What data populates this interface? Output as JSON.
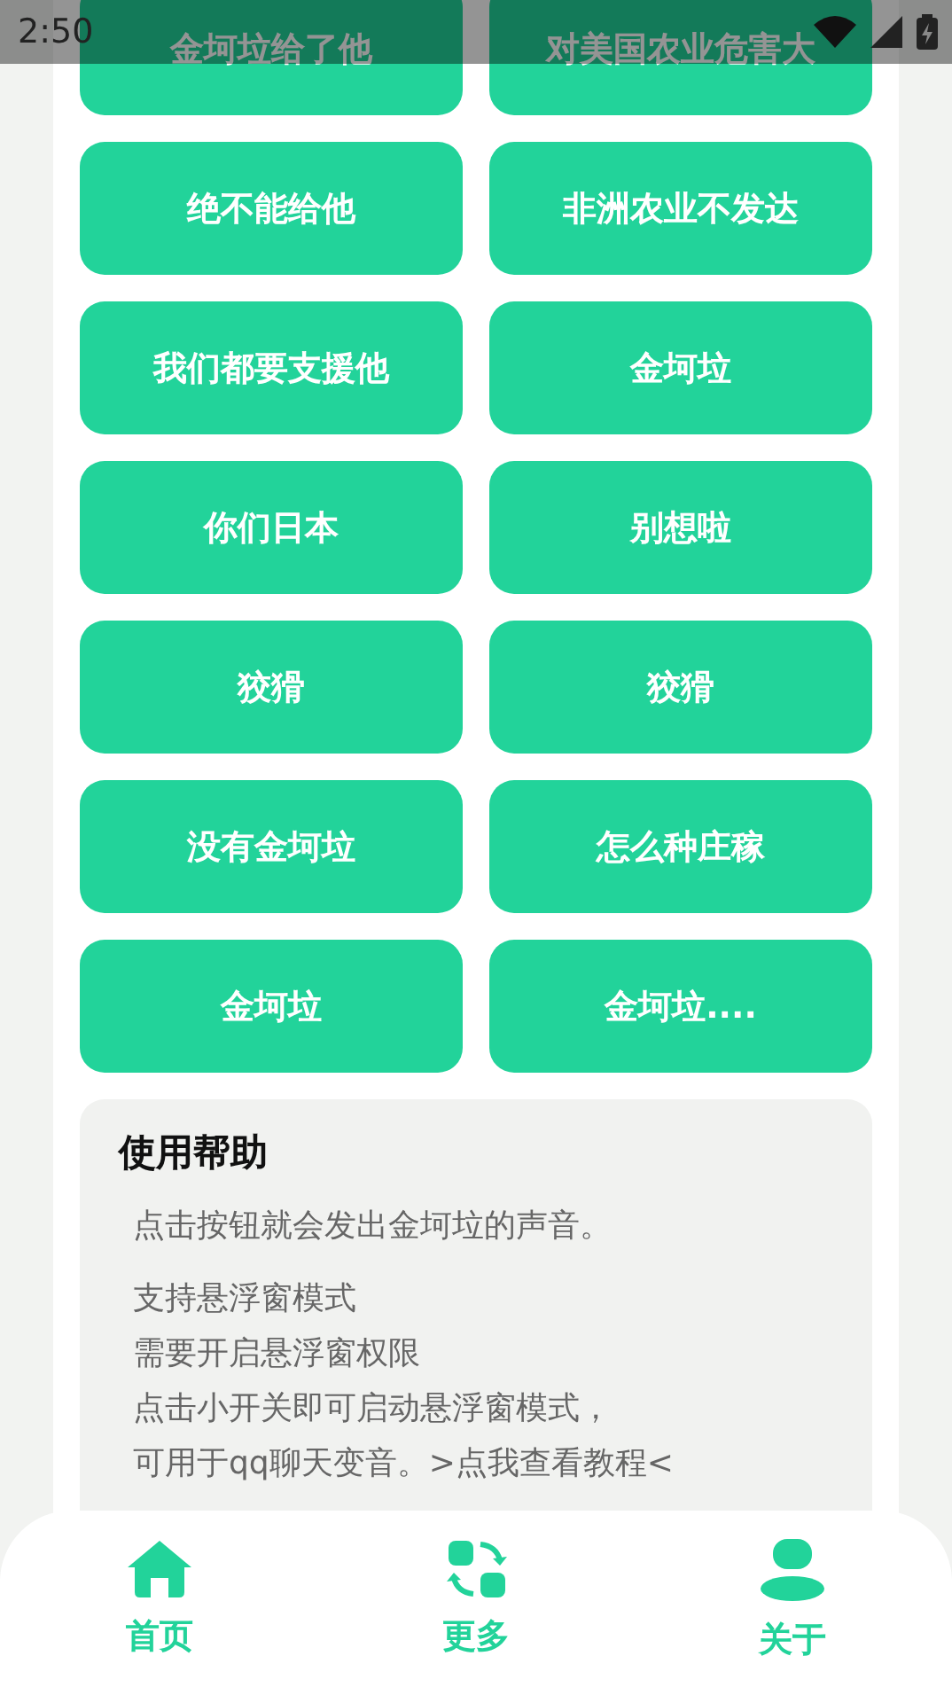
{
  "status_bar": {
    "time": "2:50"
  },
  "sound_buttons": [
    {
      "label": "金坷垃给了他"
    },
    {
      "label": "对美国农业危害大"
    },
    {
      "label": "绝不能给他"
    },
    {
      "label": "非洲农业不发达"
    },
    {
      "label": "我们都要支援他"
    },
    {
      "label": "金坷垃"
    },
    {
      "label": "你们日本"
    },
    {
      "label": "别想啦"
    },
    {
      "label": "狡猾"
    },
    {
      "label": "狡猾"
    },
    {
      "label": "没有金坷垃"
    },
    {
      "label": "怎么种庄稼"
    },
    {
      "label": "金坷垃"
    },
    {
      "label": "金坷垃...."
    }
  ],
  "help": {
    "title": "使用帮助",
    "intro": "点击按钮就会发出金坷垃的声音。",
    "lines": [
      "支持悬浮窗模式",
      "需要开启悬浮窗权限",
      "点击小开关即可启动悬浮窗模式，",
      "可用于qq聊天变音。>点我查看教程<"
    ]
  },
  "bottom_nav": [
    {
      "label": "首页"
    },
    {
      "label": "更多"
    },
    {
      "label": "关于"
    }
  ]
}
